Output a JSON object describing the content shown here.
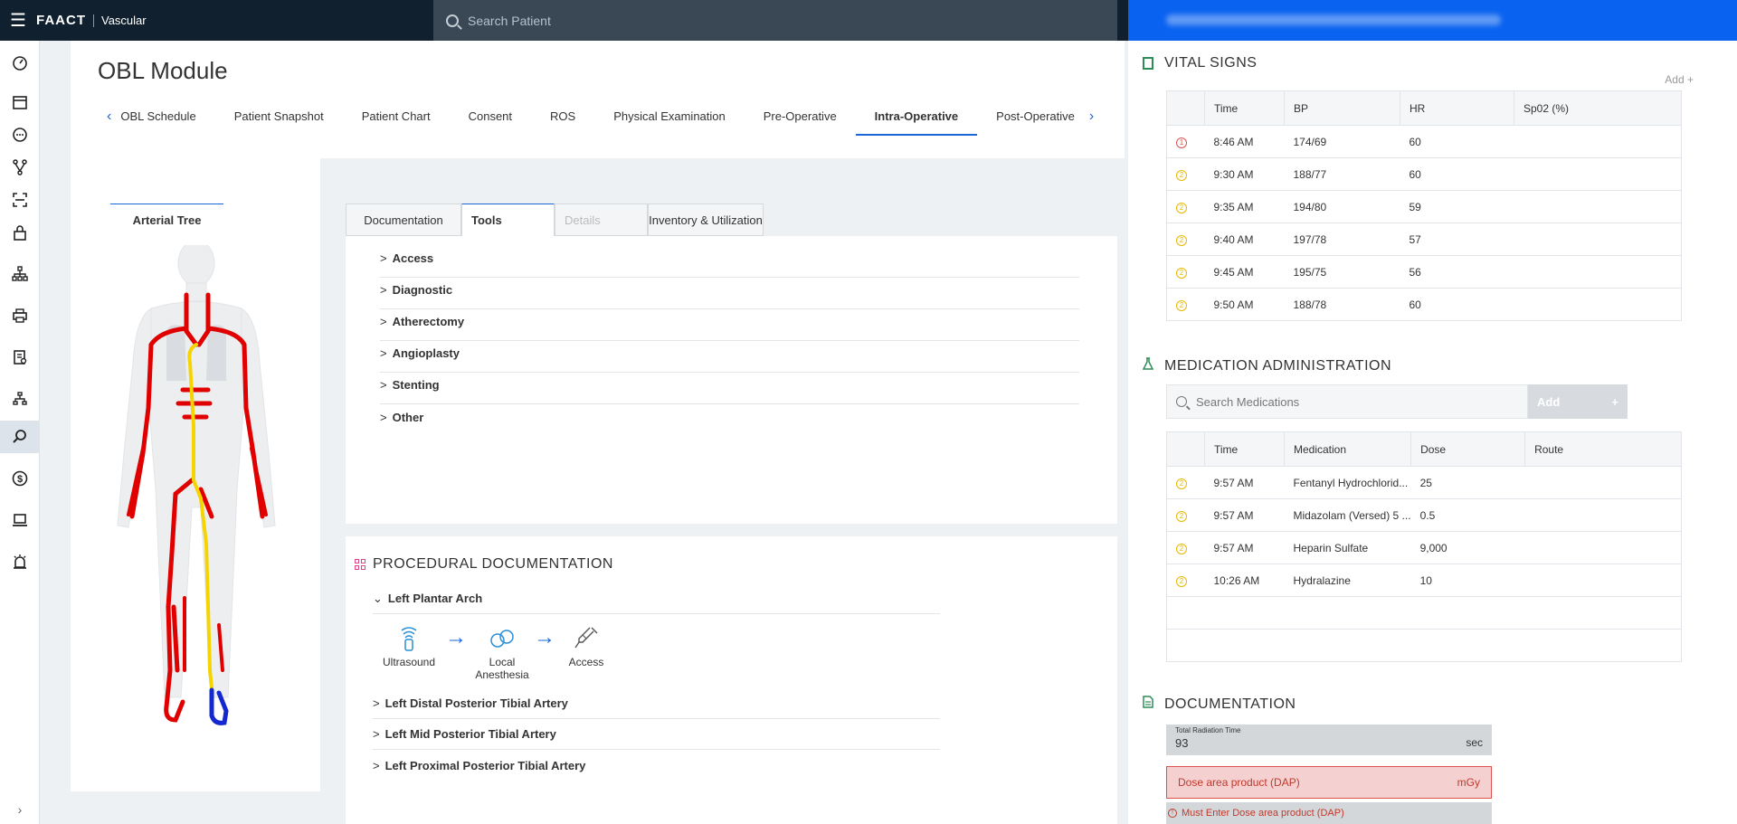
{
  "app": {
    "brand": "FAACT",
    "product": "Vascular"
  },
  "search": {
    "placeholder": "Search Patient"
  },
  "page": {
    "title": "OBL Module"
  },
  "tabs": [
    {
      "label": "OBL Schedule"
    },
    {
      "label": "Patient Snapshot"
    },
    {
      "label": "Patient Chart"
    },
    {
      "label": "Consent"
    },
    {
      "label": "ROS"
    },
    {
      "label": "Physical Examination"
    },
    {
      "label": "Pre-Operative"
    },
    {
      "label": "Intra-Operative"
    },
    {
      "label": "Post-Operative"
    }
  ],
  "tree": {
    "tab_label": "Arterial Tree"
  },
  "subtabs": [
    {
      "label": "Documentation"
    },
    {
      "label": "Tools"
    },
    {
      "label": "Details"
    },
    {
      "label": "Inventory & Utilization"
    }
  ],
  "tools": [
    {
      "label": "Access"
    },
    {
      "label": "Diagnostic"
    },
    {
      "label": "Atherectomy"
    },
    {
      "label": "Angioplasty"
    },
    {
      "label": "Stenting"
    },
    {
      "label": "Other"
    }
  ],
  "procedural": {
    "title": "PROCEDURAL DOCUMENTATION",
    "sections": [
      {
        "label": "Left Plantar Arch"
      },
      {
        "label": "Left Distal Posterior Tibial Artery"
      },
      {
        "label": "Left Mid Posterior Tibial Artery"
      },
      {
        "label": "Left Proximal Posterior Tibial Artery"
      }
    ],
    "steps": [
      {
        "label": "Ultrasound",
        "icon": "ultrasound-icon"
      },
      {
        "label": "Local Anesthesia",
        "icon": "anesthesia-icon"
      },
      {
        "label": "Access",
        "icon": "syringe-icon"
      }
    ]
  },
  "vitals": {
    "title": "VITAL SIGNS",
    "add_label": "Add +",
    "headers": [
      "Time",
      "BP",
      "HR",
      "Sp02 (%)"
    ],
    "rows": [
      {
        "status": "1",
        "time": "8:46 AM",
        "bp": "174/69",
        "hr": "60",
        "spo2": ""
      },
      {
        "status": "2",
        "time": "9:30 AM",
        "bp": "188/77",
        "hr": "60",
        "spo2": ""
      },
      {
        "status": "2",
        "time": "9:35 AM",
        "bp": "194/80",
        "hr": "59",
        "spo2": ""
      },
      {
        "status": "2",
        "time": "9:40 AM",
        "bp": "197/78",
        "hr": "57",
        "spo2": ""
      },
      {
        "status": "2",
        "time": "9:45 AM",
        "bp": "195/75",
        "hr": "56",
        "spo2": ""
      },
      {
        "status": "2",
        "time": "9:50 AM",
        "bp": "188/78",
        "hr": "60",
        "spo2": ""
      }
    ]
  },
  "medication": {
    "title": "MEDICATION ADMINISTRATION",
    "search_placeholder": "Search Medications",
    "add_label": "Add",
    "add_plus": "+",
    "headers": [
      "Time",
      "Medication",
      "Dose",
      "Route"
    ],
    "rows": [
      {
        "status": "2",
        "time": "9:57 AM",
        "medication": "Fentanyl Hydrochlorid...",
        "dose": "25",
        "route": ""
      },
      {
        "status": "2",
        "time": "9:57 AM",
        "medication": "Midazolam (Versed) 5 ...",
        "dose": "0.5",
        "route": ""
      },
      {
        "status": "2",
        "time": "9:57 AM",
        "medication": "Heparin Sulfate",
        "dose": "9,000",
        "route": ""
      },
      {
        "status": "2",
        "time": "10:26 AM",
        "medication": "Hydralazine",
        "dose": "10",
        "route": ""
      }
    ]
  },
  "documentation": {
    "title": "DOCUMENTATION",
    "radiation_label": "Total Radiation Time",
    "radiation_value": "93",
    "radiation_unit": "sec",
    "dap_placeholder": "Dose area product (DAP)",
    "dap_unit": "mGy",
    "dap_error": "Must Enter Dose area product (DAP)"
  },
  "colors": {
    "accent": "#1a66d9",
    "header_bg": "#10202f",
    "right_header": "#0a63f0",
    "error": "#d9534f",
    "artery_red": "#e00000",
    "artery_yellow": "#f5d400",
    "artery_blue": "#1428d0"
  },
  "nav_icons": [
    "dashboard-icon",
    "calendar-icon",
    "chat-icon",
    "branch-icon",
    "scan-icon",
    "lock-icon",
    "hierarchy-icon",
    "print-icon",
    "report-icon",
    "org-icon",
    "search-icon",
    "dollar-icon",
    "laptop-icon",
    "alarm-icon"
  ]
}
